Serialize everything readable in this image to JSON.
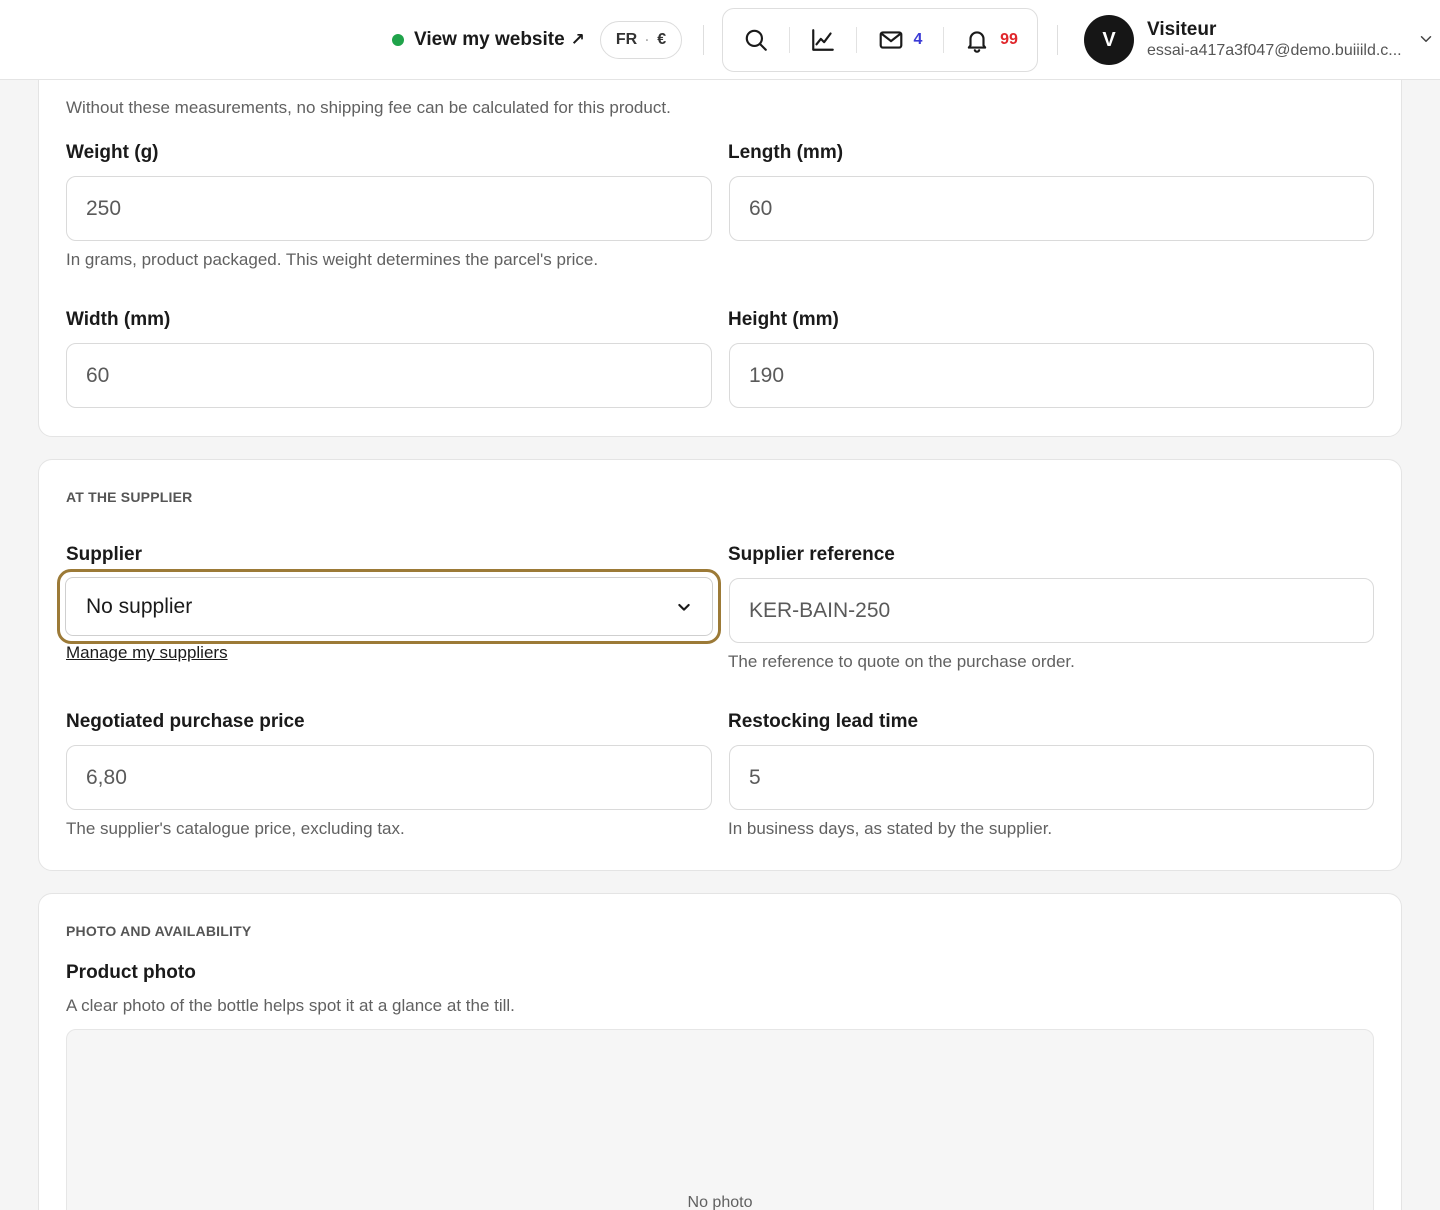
{
  "header": {
    "site_link_label": "View my website",
    "site_link_arrow": "↗",
    "site_status_color": "#1fa34a",
    "locale": "FR",
    "currency": "€",
    "locale_separator": "·",
    "tools": {
      "search_icon": "search-icon",
      "stats_icon": "chart-line-icon",
      "messages_icon": "mail-icon",
      "messages_count": "4",
      "notifications_icon": "bell-icon",
      "notifications_count": "99"
    },
    "user": {
      "initial": "V",
      "name": "Visiteur",
      "email": "essai-a417a3f047@demo.buiiild.c..."
    }
  },
  "dimensions_section": {
    "intro": "Without these measurements, no shipping fee can be calculated for this product.",
    "weight": {
      "label": "Weight (g)",
      "value": "250",
      "help": "In grams, product packaged. This weight determines the parcel's price."
    },
    "length": {
      "label": "Length (mm)",
      "value": "60"
    },
    "width": {
      "label": "Width (mm)",
      "value": "60"
    },
    "height": {
      "label": "Height (mm)",
      "value": "190"
    }
  },
  "supplier_section": {
    "title": "AT THE SUPPLIER",
    "supplier": {
      "label": "Supplier",
      "selected": "No supplier",
      "focus_color": "#9c7a37"
    },
    "manage_link": "Manage my suppliers",
    "supplier_reference": {
      "label": "Supplier reference",
      "value": "KER-BAIN-250",
      "help": "The reference to quote on the purchase order."
    },
    "purchase_price": {
      "label": "Negotiated purchase price",
      "value": "6,80",
      "help": "The supplier's catalogue price, excluding tax."
    },
    "lead_time": {
      "label": "Restocking lead time",
      "value": "5",
      "help": "In business days, as stated by the supplier."
    }
  },
  "photo_section": {
    "title": "PHOTO AND AVAILABILITY",
    "photo_label": "Product photo",
    "photo_help": "A clear photo of the bottle helps spot it at a glance at the till.",
    "no_photo": "No photo"
  }
}
